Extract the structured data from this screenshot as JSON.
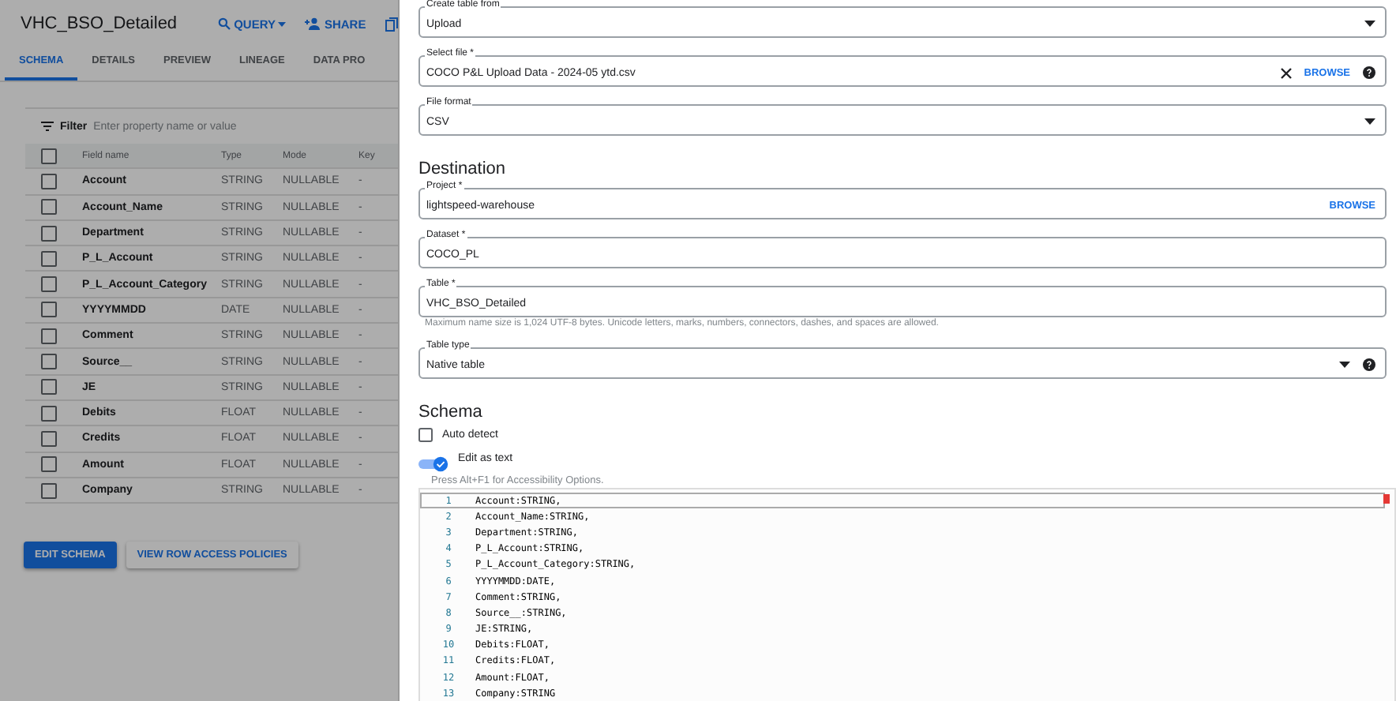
{
  "page": {
    "title": "VHC_BSO_Detailed",
    "actions": [
      {
        "kind": "query",
        "label": "QUERY"
      },
      {
        "kind": "share",
        "label": "SHARE"
      },
      {
        "kind": "copy"
      }
    ],
    "tabs": [
      {
        "label": "SCHEMA",
        "selected": true
      },
      {
        "label": "DETAILS",
        "selected": false
      },
      {
        "label": "PREVIEW",
        "selected": false
      },
      {
        "label": "LINEAGE",
        "selected": false
      },
      {
        "label": "DATA PRO",
        "selected": false
      }
    ],
    "select_all": {
      "checked": false
    },
    "filter": {
      "label": "Filter",
      "placeholder": "Enter property name or value"
    },
    "columns": [
      "Field name",
      "Type",
      "Mode",
      "Key"
    ],
    "rows": [
      {
        "name": "Account",
        "type": "STRING",
        "mode": "NULLABLE",
        "key": "-",
        "checked": false
      },
      {
        "name": "Account_Name",
        "type": "STRING",
        "mode": "NULLABLE",
        "key": "-",
        "checked": false
      },
      {
        "name": "Department",
        "type": "STRING",
        "mode": "NULLABLE",
        "key": "-",
        "checked": false
      },
      {
        "name": "P_L_Account",
        "type": "STRING",
        "mode": "NULLABLE",
        "key": "-",
        "checked": false
      },
      {
        "name": "P_L_Account_Category",
        "type": "STRING",
        "mode": "NULLABLE",
        "key": "-",
        "checked": false
      },
      {
        "name": "YYYYMMDD",
        "type": "DATE",
        "mode": "NULLABLE",
        "key": "-",
        "checked": false
      },
      {
        "name": "Comment",
        "type": "STRING",
        "mode": "NULLABLE",
        "key": "-",
        "checked": false
      },
      {
        "name": "Source__",
        "type": "STRING",
        "mode": "NULLABLE",
        "key": "-",
        "checked": false
      },
      {
        "name": "JE",
        "type": "STRING",
        "mode": "NULLABLE",
        "key": "-",
        "checked": false
      },
      {
        "name": "Debits",
        "type": "FLOAT",
        "mode": "NULLABLE",
        "key": "-",
        "checked": false
      },
      {
        "name": "Credits",
        "type": "FLOAT",
        "mode": "NULLABLE",
        "key": "-",
        "checked": false
      },
      {
        "name": "Amount",
        "type": "FLOAT",
        "mode": "NULLABLE",
        "key": "-",
        "checked": false
      },
      {
        "name": "Company",
        "type": "STRING",
        "mode": "NULLABLE",
        "key": "-",
        "checked": false
      }
    ],
    "buttons": [
      {
        "label": "EDIT SCHEMA",
        "kind": "primary"
      },
      {
        "label": "VIEW ROW ACCESS POLICIES",
        "kind": "secondary"
      }
    ]
  },
  "panel": {
    "sections": [
      {
        "fields": [
          {
            "kind": "select",
            "label": "Create table from",
            "value": "Upload"
          },
          {
            "kind": "file",
            "label": "Select file *",
            "value": "COCO P&L Upload Data - 2024-05 ytd.csv",
            "action": "BROWSE",
            "help": true
          },
          {
            "kind": "select",
            "label": "File format",
            "value": "CSV"
          }
        ]
      },
      {
        "heading": "Destination",
        "fields": [
          {
            "kind": "text",
            "label": "Project *",
            "value": "lightspeed-warehouse",
            "action": "BROWSE"
          },
          {
            "kind": "text",
            "label": "Dataset *",
            "value": "COCO_PL"
          },
          {
            "kind": "text",
            "label": "Table *",
            "value": "VHC_BSO_Detailed",
            "hint": "Maximum name size is 1,024 UTF-8 bytes. Unicode letters, marks, numbers, connectors, dashes, and spaces are allowed."
          },
          {
            "kind": "select",
            "label": "Table type",
            "value": "Native table",
            "help": true
          }
        ]
      }
    ],
    "schema": {
      "heading": "Schema",
      "auto_detect": {
        "label": "Auto detect",
        "checked": false
      },
      "edit_as_text": {
        "label": "Edit as text",
        "on": true
      },
      "editor": {
        "hint": "Press Alt+F1 for Accessibility Options.",
        "lines": [
          {
            "number": "1",
            "text": "Account:STRING,"
          },
          {
            "number": "2",
            "text": "Account_Name:STRING,"
          },
          {
            "number": "3",
            "text": "Department:STRING,"
          },
          {
            "number": "4",
            "text": "P_L_Account:STRING,"
          },
          {
            "number": "5",
            "text": "P_L_Account_Category:STRING,"
          },
          {
            "number": "6",
            "text": "YYYYMMDD:DATE,"
          },
          {
            "number": "7",
            "text": "Comment:STRING,"
          },
          {
            "number": "8",
            "text": "Source__:STRING,"
          },
          {
            "number": "9",
            "text": "JE:STRING,"
          },
          {
            "number": "10",
            "text": "Debits:FLOAT,"
          },
          {
            "number": "11",
            "text": "Credits:FLOAT,"
          },
          {
            "number": "12",
            "text": "Amount:FLOAT,"
          },
          {
            "number": "13",
            "text": "Company:STRING"
          }
        ]
      }
    }
  }
}
